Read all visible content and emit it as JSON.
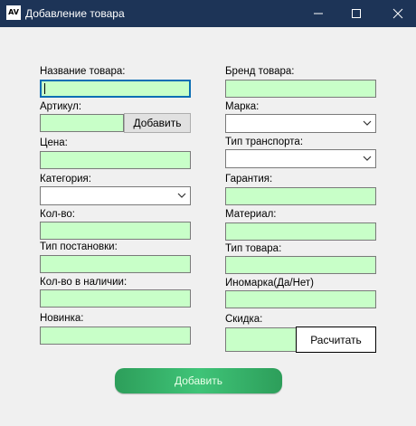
{
  "window": {
    "title": "Добавление товара",
    "icon_text": "AV",
    "icon_names": [
      "minimize-icon",
      "maximize-icon",
      "close-icon"
    ]
  },
  "form": {
    "left": {
      "name_label": "Название товара:",
      "article_label": "Артикул:",
      "article_add_button": "Добавить",
      "price_label": "Цена:",
      "category_label": "Категория:",
      "category_value": "",
      "quantity_label": "Кол-во:",
      "install_type_label": "Тип постановки:",
      "in_stock_label": "Кол-во в наличии:",
      "novelty_label": "Новинка:"
    },
    "right": {
      "brand_label": "Бренд товара:",
      "make_label": "Марка:",
      "make_value": "",
      "transport_type_label": "Тип транспорта:",
      "transport_type_value": "",
      "warranty_label": "Гарантия:",
      "material_label": "Материал:",
      "product_type_label": "Тип товара:",
      "foreign_brand_label": "Иномарка(Да/Нет)",
      "discount_label": "Скидка:",
      "calculate_button": "Расчитать"
    },
    "submit_button": "Добавить"
  },
  "colors": {
    "titlebar": "#1d3457",
    "field_bg": "#c8ffc8",
    "focus_border": "#0a6eb4",
    "submit_green": "#3fc478",
    "window_bg": "#f0f0f0"
  }
}
